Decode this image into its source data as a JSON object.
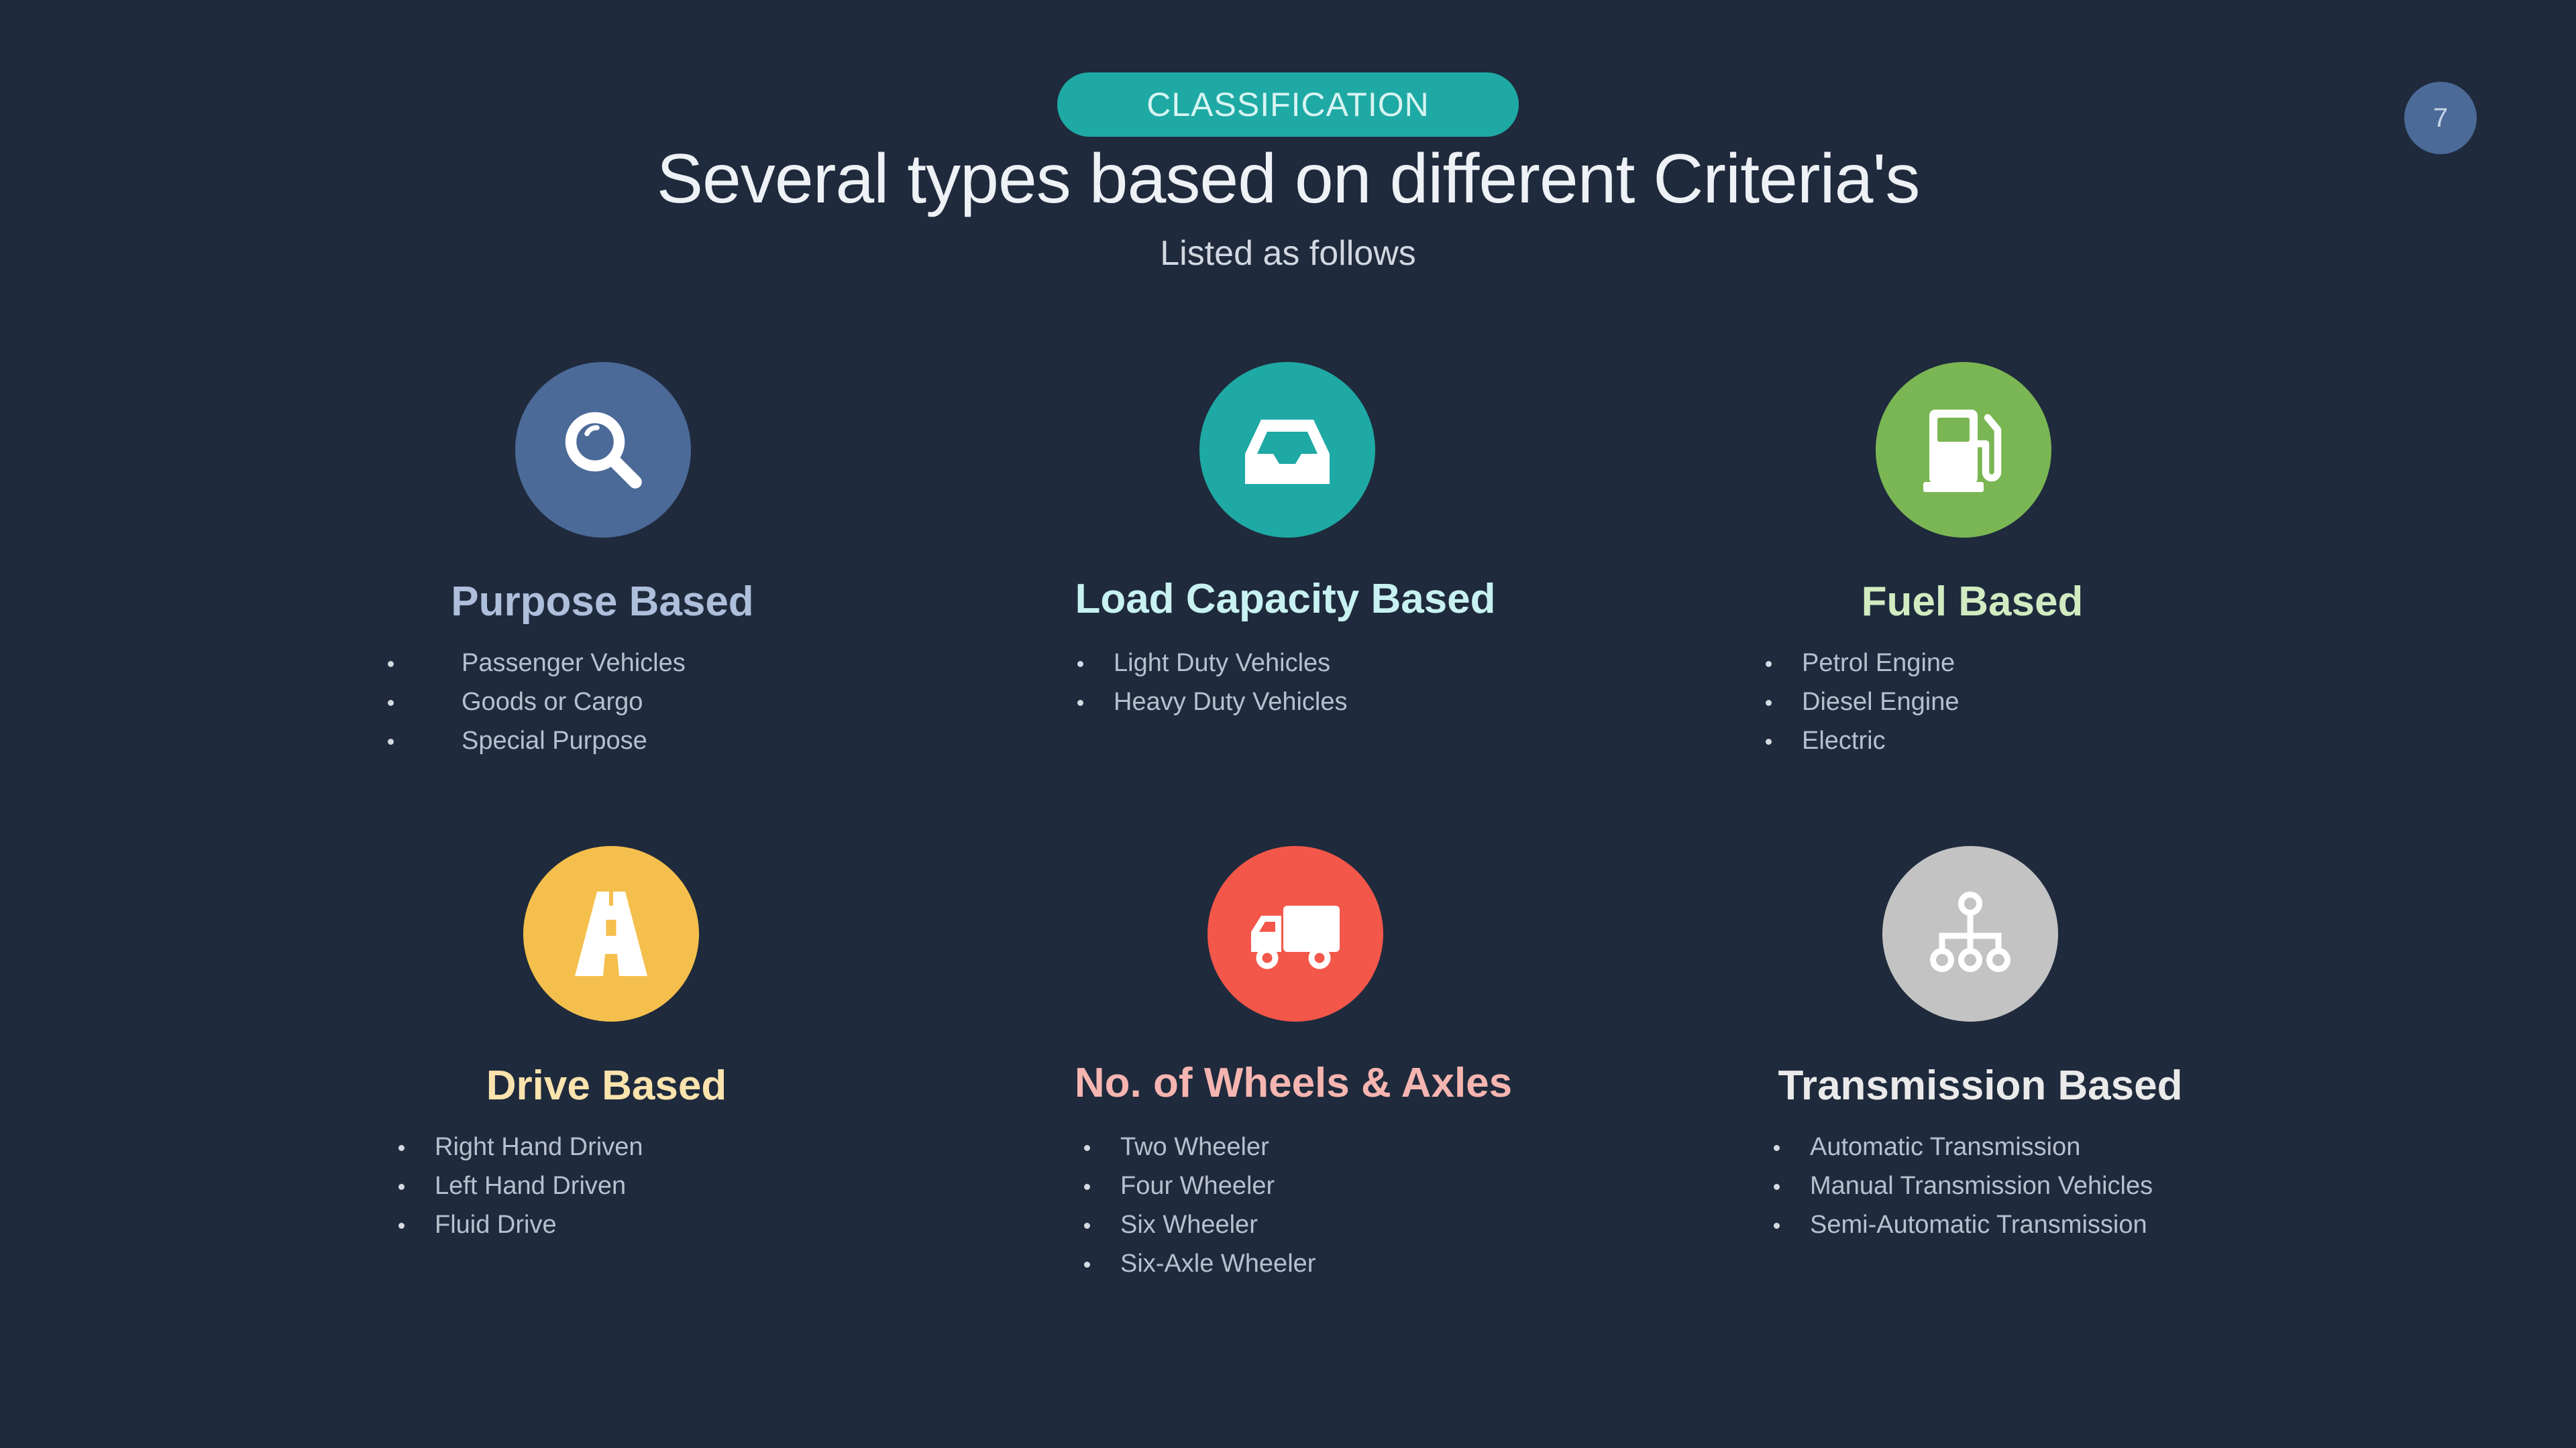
{
  "header": {
    "badge": "CLASSIFICATION",
    "title": "Several types based on different Criteria's",
    "subtitle": "Listed as follows",
    "page_number": "7"
  },
  "colors": {
    "background": "#1f2a3c",
    "badge": "#1fa9a4",
    "page_number": "#4b6a98"
  },
  "categories": [
    {
      "icon": "search-icon",
      "circle_color": "#4b6a98",
      "heading_color": "#aebfdc",
      "heading": "Purpose Based",
      "items": [
        "Passenger Vehicles",
        "Goods or Cargo",
        "Special Purpose"
      ]
    },
    {
      "icon": "inbox-tray-icon",
      "circle_color": "#1fa9a4",
      "heading_color": "#c8f2f2",
      "heading": "Load Capacity Based",
      "items": [
        "Light Duty Vehicles",
        "Heavy Duty Vehicles"
      ]
    },
    {
      "icon": "fuel-pump-icon",
      "circle_color": "#7bb654",
      "heading_color": "#d2ebc0",
      "heading": "Fuel Based",
      "items": [
        "Petrol Engine",
        "Diesel Engine",
        "Electric"
      ]
    },
    {
      "icon": "road-icon",
      "circle_color": "#f5bf4d",
      "heading_color": "#fbe3ad",
      "heading": "Drive Based",
      "items": [
        "Right Hand Driven",
        "Left Hand Driven",
        "Fluid Drive"
      ]
    },
    {
      "icon": "truck-icon",
      "circle_color": "#f2574a",
      "heading_color": "#f6b5b0",
      "heading": "No. of Wheels & Axles",
      "items": [
        "Two Wheeler",
        "Four Wheeler",
        "Six Wheeler",
        "Six-Axle Wheeler"
      ]
    },
    {
      "icon": "sitemap-icon",
      "circle_color": "#c3c3c3",
      "heading_color": "#eaeaea",
      "heading": "Transmission Based",
      "items": [
        "Automatic Transmission",
        "Manual Transmission Vehicles",
        "Semi-Automatic Transmission"
      ]
    }
  ]
}
